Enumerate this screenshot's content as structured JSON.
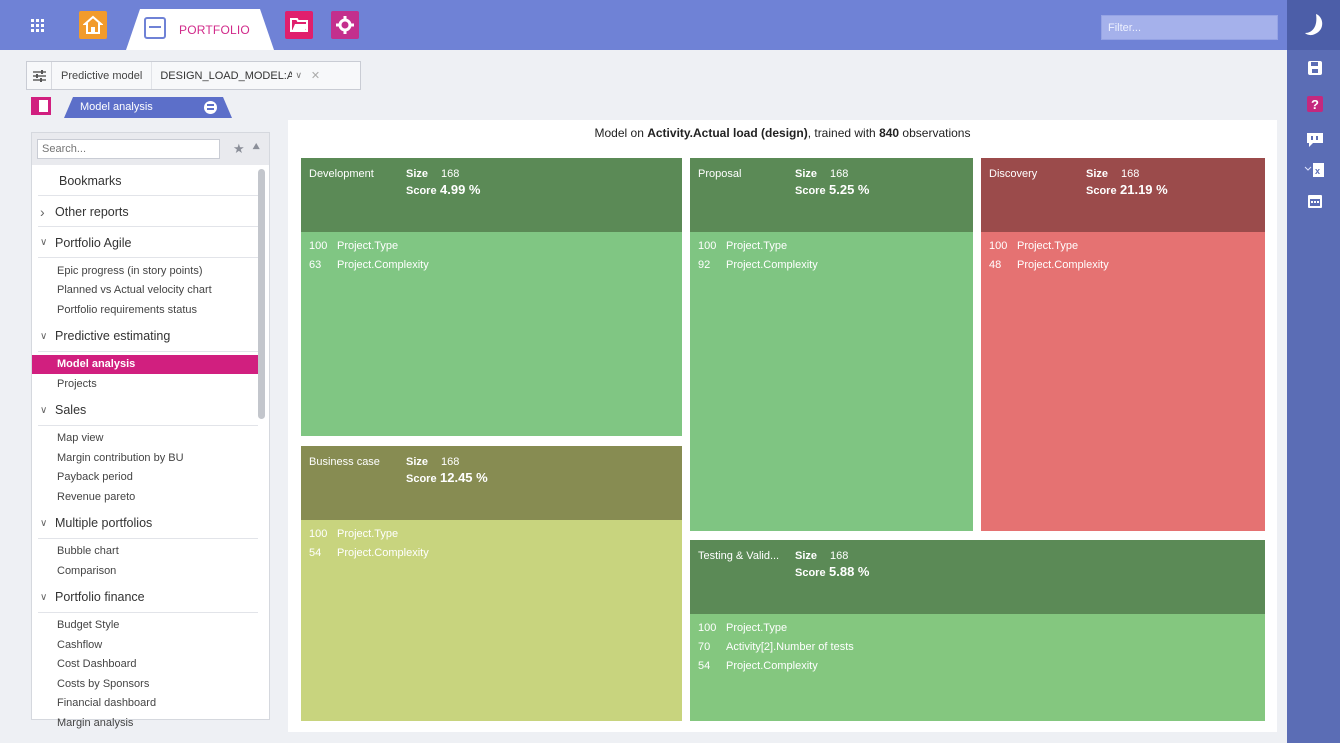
{
  "topbar": {
    "portfolio_tab_label": "PORTFOLIO",
    "filter_placeholder": "Filter...",
    "colors": {
      "bar": "#6f82d6",
      "home": "#f29b2c",
      "folder": "#e01f6d",
      "settings": "#c42f8d",
      "accent": "#d12a8a"
    }
  },
  "model_selector": {
    "label": "Predictive model",
    "value": "DESIGN_LOAD_MODEL:Activit"
  },
  "view_tab": {
    "label": "Model analysis"
  },
  "sidebar": {
    "search_placeholder": "Search...",
    "sections": [
      {
        "type": "section",
        "label": "Bookmarks",
        "chevron": ""
      },
      {
        "type": "section",
        "label": "Other reports",
        "chevron": ">"
      },
      {
        "type": "section",
        "label": "Portfolio Agile",
        "chevron": "v"
      },
      {
        "type": "item",
        "label": "Epic progress (in story points)"
      },
      {
        "type": "item",
        "label": "Planned vs Actual velocity chart"
      },
      {
        "type": "item",
        "label": "Portfolio requirements status"
      },
      {
        "type": "section",
        "label": "Predictive estimating",
        "chevron": "v"
      },
      {
        "type": "item",
        "label": "Model analysis",
        "active": true
      },
      {
        "type": "item",
        "label": "Projects"
      },
      {
        "type": "section",
        "label": "Sales",
        "chevron": "v"
      },
      {
        "type": "item",
        "label": "Map view"
      },
      {
        "type": "item",
        "label": "Margin contribution by BU"
      },
      {
        "type": "item",
        "label": "Payback period"
      },
      {
        "type": "item",
        "label": "Revenue pareto"
      },
      {
        "type": "section",
        "label": "Multiple portfolios",
        "chevron": "v"
      },
      {
        "type": "item",
        "label": "Bubble chart"
      },
      {
        "type": "item",
        "label": "Comparison"
      },
      {
        "type": "section",
        "label": "Portfolio finance",
        "chevron": "v"
      },
      {
        "type": "item",
        "label": "Budget Style"
      },
      {
        "type": "item",
        "label": "Cashflow"
      },
      {
        "type": "item",
        "label": "Cost Dashboard"
      },
      {
        "type": "item",
        "label": "Costs by Sponsors"
      },
      {
        "type": "item",
        "label": "Financial dashboard"
      },
      {
        "type": "item",
        "label": "Margin analysis"
      }
    ]
  },
  "content": {
    "title_prefix": "Model on ",
    "title_target": "Activity.Actual load (design)",
    "title_mid": ", trained with ",
    "title_count": "840",
    "title_suffix": " observations"
  },
  "treemap": {
    "size_label": "Size",
    "score_label": "Score",
    "tiles": [
      {
        "name": "Development",
        "size": "168",
        "score": "4.99 %",
        "head_color": "#5b8a56",
        "body_color": "#80c683",
        "features": [
          {
            "value": "100",
            "name": "Project.Type"
          },
          {
            "value": "63",
            "name": "Project.Complexity"
          }
        ]
      },
      {
        "name": "Proposal",
        "size": "168",
        "score": "5.25 %",
        "head_color": "#5b8a56",
        "body_color": "#7fc582",
        "features": [
          {
            "value": "100",
            "name": "Project.Type"
          },
          {
            "value": "92",
            "name": "Project.Complexity"
          }
        ]
      },
      {
        "name": "Discovery",
        "size": "168",
        "score": "21.19 %",
        "head_color": "#9b4b4b",
        "body_color": "#e57272",
        "features": [
          {
            "value": "100",
            "name": "Project.Type"
          },
          {
            "value": "48",
            "name": "Project.Complexity"
          }
        ]
      },
      {
        "name": "Business case",
        "size": "168",
        "score": "12.45 %",
        "head_color": "#878c52",
        "body_color": "#c8d47e",
        "features": [
          {
            "value": "100",
            "name": "Project.Type"
          },
          {
            "value": "54",
            "name": "Project.Complexity"
          }
        ]
      },
      {
        "name": "Testing & Valid...",
        "size": "168",
        "score": "5.88 %",
        "head_color": "#5b8a56",
        "body_color": "#84c77f",
        "features": [
          {
            "value": "100",
            "name": "Project.Type"
          },
          {
            "value": "70",
            "name": "Activity[2].Number of tests"
          },
          {
            "value": "54",
            "name": "Project.Complexity"
          }
        ]
      }
    ]
  }
}
